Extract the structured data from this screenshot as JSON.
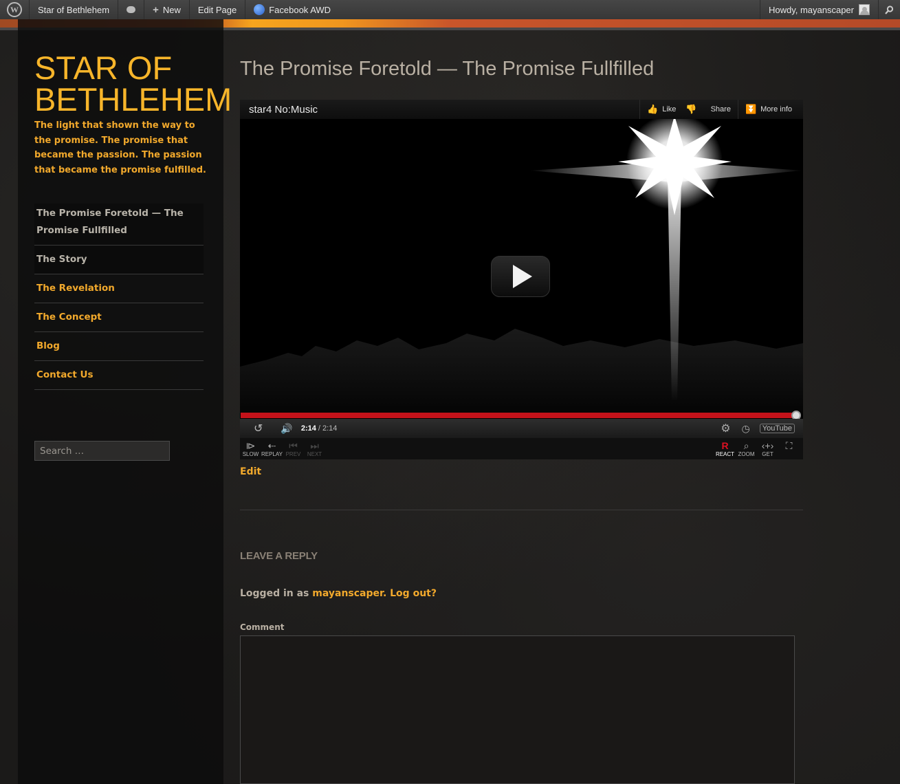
{
  "admin_bar": {
    "site_name": "Star of Bethlehem",
    "new_label": "New",
    "edit_page_label": "Edit Page",
    "facebook_label": "Facebook AWD",
    "howdy_label": "Howdy, mayanscaper",
    "icons": [
      "wordpress-logo-icon",
      "comment-bubble-icon",
      "plus-icon",
      "facebook-awd-icon",
      "avatar",
      "search-icon"
    ]
  },
  "site": {
    "title": "STAR OF BETHLEHEM",
    "description": "The light that shown the way to the promise. The promise that became the passion. The passion that became the promise fulfilled."
  },
  "nav": {
    "items": [
      {
        "label": "The Promise Foretold — The Promise Fullfilled",
        "current": true
      },
      {
        "label": "The Story"
      },
      {
        "label": "The Revelation"
      },
      {
        "label": "The Concept"
      },
      {
        "label": "Blog"
      },
      {
        "label": "Contact Us"
      }
    ]
  },
  "search": {
    "placeholder": "Search …"
  },
  "entry": {
    "title": "The Promise Foretold — The Promise Fullfilled",
    "edit_label": "Edit"
  },
  "video": {
    "title": "star4 No:Music",
    "like_label": "Like",
    "share_label": "Share",
    "more_info_label": "More info",
    "time_current": "2:14",
    "time_total": "/ 2:14",
    "progress": 1.0,
    "youtube_label": "YouTube",
    "controls": {
      "slow": "SLOW",
      "replay": "REPLAY",
      "prev": "PREV",
      "next": "NEXT",
      "react": "REACT",
      "zoom": "ZOOM",
      "get": "GET"
    }
  },
  "reply": {
    "title": "LEAVE A REPLY",
    "logged_in_prefix": "Logged in as ",
    "user_link": "mayanscaper",
    "logout_link": "Log out?",
    "comment_label": "Comment"
  },
  "colors": {
    "accent": "#f2a92c",
    "title": "#f7b52a",
    "progress": "#c4121a"
  }
}
